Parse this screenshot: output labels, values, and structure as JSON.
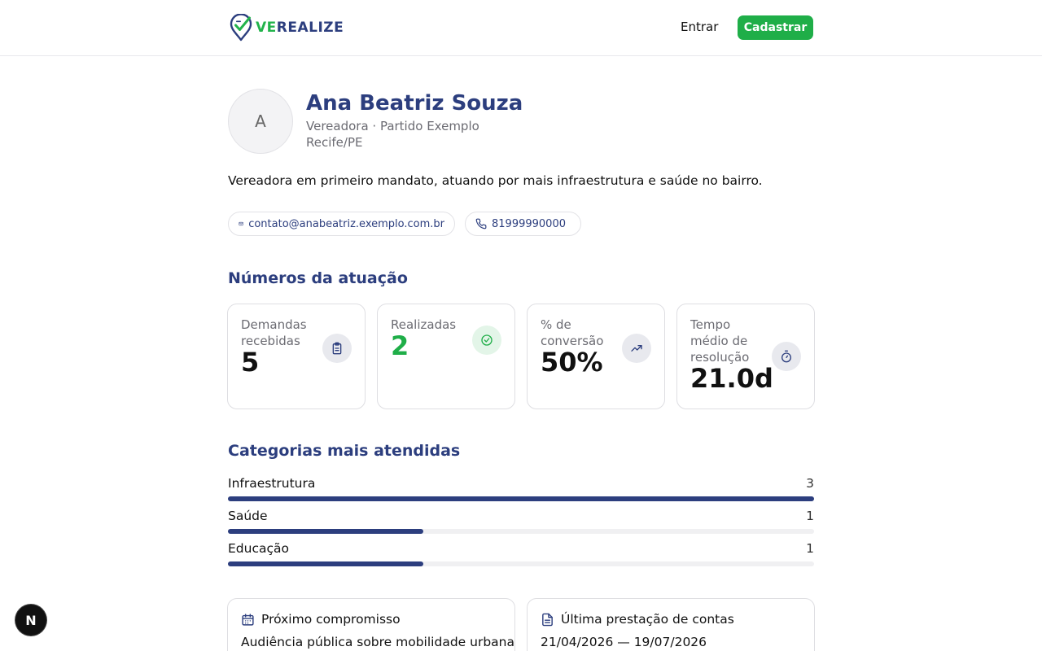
{
  "header": {
    "logo": {
      "prefix": "VE",
      "rest": "REALIZE"
    },
    "login_label": "Entrar",
    "signup_label": "Cadastrar"
  },
  "profile": {
    "avatar_initial": "A",
    "name": "Ana Beatriz Souza",
    "role": "Vereadora · Partido Exemplo",
    "city": "Recife/PE",
    "bio": "Vereadora em primeiro mandato, atuando por mais infraestrutura e saúde no bairro.",
    "email": "contato@anabeatriz.exemplo.com.br",
    "phone": "81999990000"
  },
  "stats": {
    "title": "Números da atuação",
    "items": [
      {
        "label": "Demandas recebidas",
        "value": "5",
        "icon": "clipboard-icon"
      },
      {
        "label": "Realizadas",
        "value": "2",
        "icon": "check-circle-icon"
      },
      {
        "label": "% de conversão",
        "value": "50%",
        "icon": "trending-up-icon"
      },
      {
        "label": "Tempo médio de resolução",
        "value": "21.0d",
        "icon": "timer-icon"
      }
    ]
  },
  "categories": {
    "title": "Categorias mais atendidas",
    "items": [
      {
        "label": "Infraestrutura",
        "count": "3",
        "fraction": 1.0
      },
      {
        "label": "Saúde",
        "count": "1",
        "fraction": 0.3333
      },
      {
        "label": "Educação",
        "count": "1",
        "fraction": 0.3333
      }
    ]
  },
  "next_event": {
    "heading": "Próximo compromisso",
    "body": "Audiência pública sobre mobilidade urbana"
  },
  "accounts": {
    "heading": "Última prestação de contas",
    "body": "21/04/2026 — 19/07/2026"
  },
  "dev_badge": {
    "letter": "N"
  },
  "colors": {
    "primary": "#2c3e7e",
    "accent": "#1fae48",
    "muted": "#6b6b72"
  }
}
